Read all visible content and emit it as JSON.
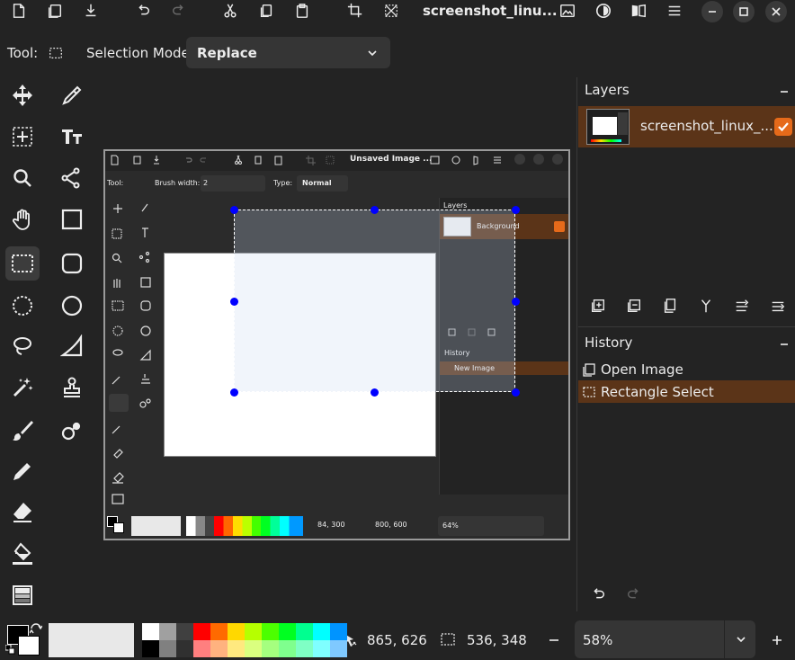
{
  "header": {
    "title": "screenshot_linu...",
    "icons": [
      "new-image-icon",
      "open-image-icon",
      "save-icon",
      "undo-icon",
      "redo-icon",
      "cut-icon",
      "copy-icon",
      "paste-icon",
      "crop-icon",
      "deselect-icon",
      "image-menu-icon",
      "adjustments-icon",
      "effects-icon",
      "main-menu-icon",
      "minimize-icon",
      "maximize-icon",
      "close-icon"
    ]
  },
  "toolbar": {
    "tool_label": "Tool:",
    "selection_mode_label": "Selection Mode:",
    "selection_mode_value": "Replace"
  },
  "tools": [
    "move-selected",
    "move-selection",
    "magic-wand? (rect zoom)",
    "text",
    "zoom",
    "path",
    "pan",
    "rectangle",
    "rectangle-select",
    "rounded-rectangle",
    "ellipse-select",
    "ellipse",
    "lasso-select",
    "freeform-shape",
    "magic-wand",
    "clone-stamp",
    "paintbrush",
    "recolor",
    "pencil",
    "eraser",
    "paint-bucket",
    "gradient"
  ],
  "layers": {
    "title": "Layers",
    "items": [
      {
        "name": "screenshot_linux_...",
        "visible": true
      }
    ]
  },
  "history": {
    "title": "History",
    "items": [
      {
        "label": "Open Image",
        "icon": "open-image-icon",
        "active": false
      },
      {
        "label": "Rectangle Select",
        "icon": "rectangle-select-icon",
        "active": true
      }
    ]
  },
  "status": {
    "cursor_position": "865, 626",
    "selection_size": "536, 348",
    "zoom": "58%"
  },
  "inner": {
    "title": "Unsaved Image ...",
    "tool_label": "Tool:",
    "brush_width_label": "Brush width:",
    "brush_width_value": "2",
    "type_label": "Type:",
    "type_value": "Normal",
    "layers_title": "Layers",
    "layer_name": "Background",
    "history_title": "History",
    "history_item": "New Image",
    "cursor_position": "84, 300",
    "selection_size": "800, 600",
    "zoom": "64%"
  },
  "colors": {
    "accent": "#e66a1a",
    "selected_row": "#5b3418",
    "background": "#232323",
    "handle": "#0000ff"
  },
  "palette_top": [
    "#ffffff",
    "#a0a0a0",
    "#404040",
    "#ff0000",
    "#ff6a00",
    "#ffd800",
    "#b6ff00",
    "#4cff00",
    "#00ff21",
    "#00ff90",
    "#00ffff",
    "#0094ff"
  ],
  "palette_bottom": [
    "#000000",
    "#808080",
    "#303030",
    "#ff7f7f",
    "#ffb27f",
    "#ffe97f",
    "#daff7f",
    "#a5ff7f",
    "#7fff8e",
    "#7fffc5",
    "#7fffff",
    "#7fc9ff"
  ]
}
